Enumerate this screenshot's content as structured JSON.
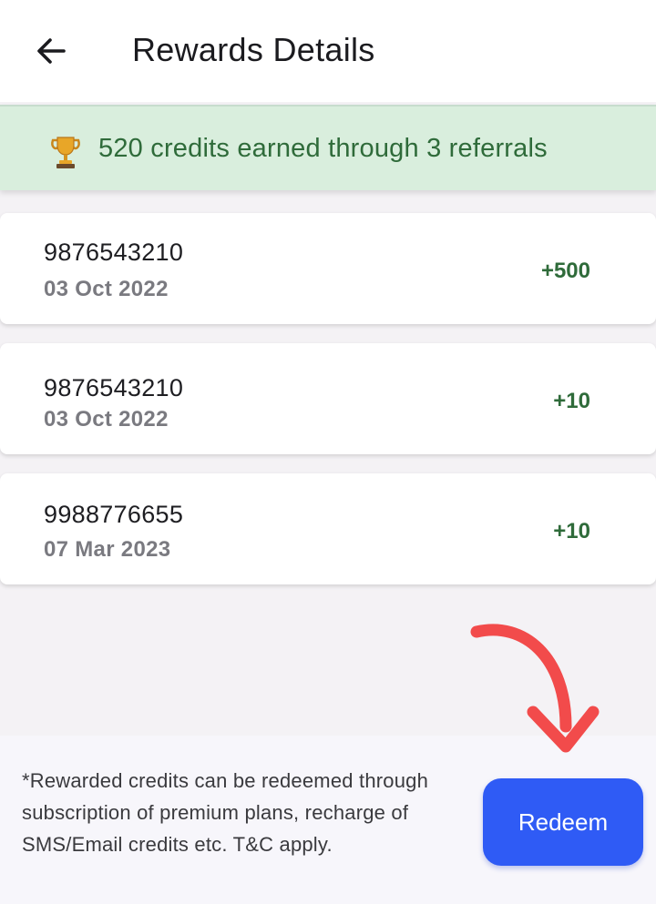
{
  "header": {
    "title": "Rewards Details",
    "back_icon": "arrow-left-icon"
  },
  "banner": {
    "icon": "trophy-icon",
    "text": "520 credits earned through 3 referrals",
    "background": "#d9eedd",
    "text_color": "#2f6b3a"
  },
  "rewards": [
    {
      "number": "9876543210",
      "date": "03 Oct 2022",
      "credit": "+500"
    },
    {
      "number": "9876543210",
      "date": "03 Oct 2022",
      "credit": "+10"
    },
    {
      "number": "9988776655",
      "date": "07 Mar 2023",
      "credit": "+10"
    }
  ],
  "footer": {
    "note": "*Rewarded credits can be redeemed through subscription of premium plans, recharge of SMS/Email credits etc. T&C apply.",
    "redeem_label": "Redeem",
    "button_color": "#2f5bf5"
  },
  "annotation": {
    "icon": "curved-arrow-icon",
    "color": "#f24b4b"
  }
}
